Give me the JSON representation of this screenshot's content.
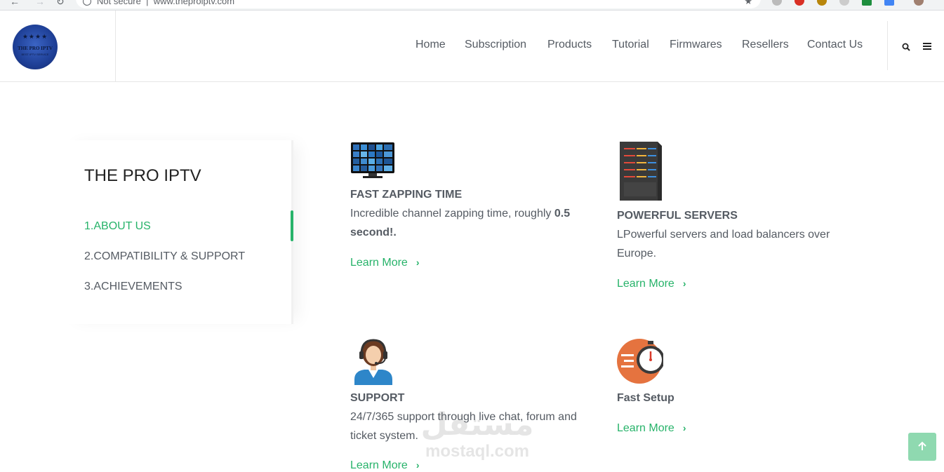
{
  "browser": {
    "url_prefix": "Not secure",
    "url": "www.theproiptv.com"
  },
  "logo": {
    "stars": "★★★★",
    "text": "THE PRO IPTV",
    "subtext": "BEST IPTV SERVICE"
  },
  "nav": {
    "items": [
      {
        "label": "Home"
      },
      {
        "label": "Subscription"
      },
      {
        "label": "Products"
      },
      {
        "label": "Tutorial"
      },
      {
        "label": "Firmwares"
      },
      {
        "label": "Resellers"
      },
      {
        "label": "Contact Us"
      }
    ]
  },
  "tabs_card": {
    "title": "THE PRO IPTV",
    "items": [
      {
        "label": "1.ABOUT US",
        "active": true
      },
      {
        "label": "2.COMPATIBILITY & SUPPORT",
        "active": false
      },
      {
        "label": "3.ACHIEVEMENTS",
        "active": false
      }
    ]
  },
  "features": [
    {
      "title": "FAST ZAPPING TIME",
      "desc_plain": "Incredible channel zapping time, roughly ",
      "desc_bold": "0.5 second!.",
      "link": "Learn More",
      "icon": "tv-wall-icon"
    },
    {
      "title": "POWERFUL SERVERS",
      "desc_plain": "LPowerful servers and load balancers over Europe.",
      "desc_bold": "",
      "link": "Learn More",
      "icon": "server-icon"
    },
    {
      "title": "SUPPORT",
      "desc_plain": "24/7/365 support through live chat, forum and ticket system.",
      "desc_bold": "",
      "link": "Learn More",
      "icon": "support-agent-icon"
    },
    {
      "title": "Fast Setup",
      "desc_plain": "",
      "desc_bold": "",
      "link": "Learn More",
      "icon": "stopwatch-icon"
    }
  ],
  "watermark": {
    "arabic": "مستقل",
    "latin": "mostaql.com"
  },
  "colors": {
    "accent": "#27b36a",
    "text": "#555b63",
    "heading": "#222222",
    "scroll_top": "#8fd9b0"
  }
}
